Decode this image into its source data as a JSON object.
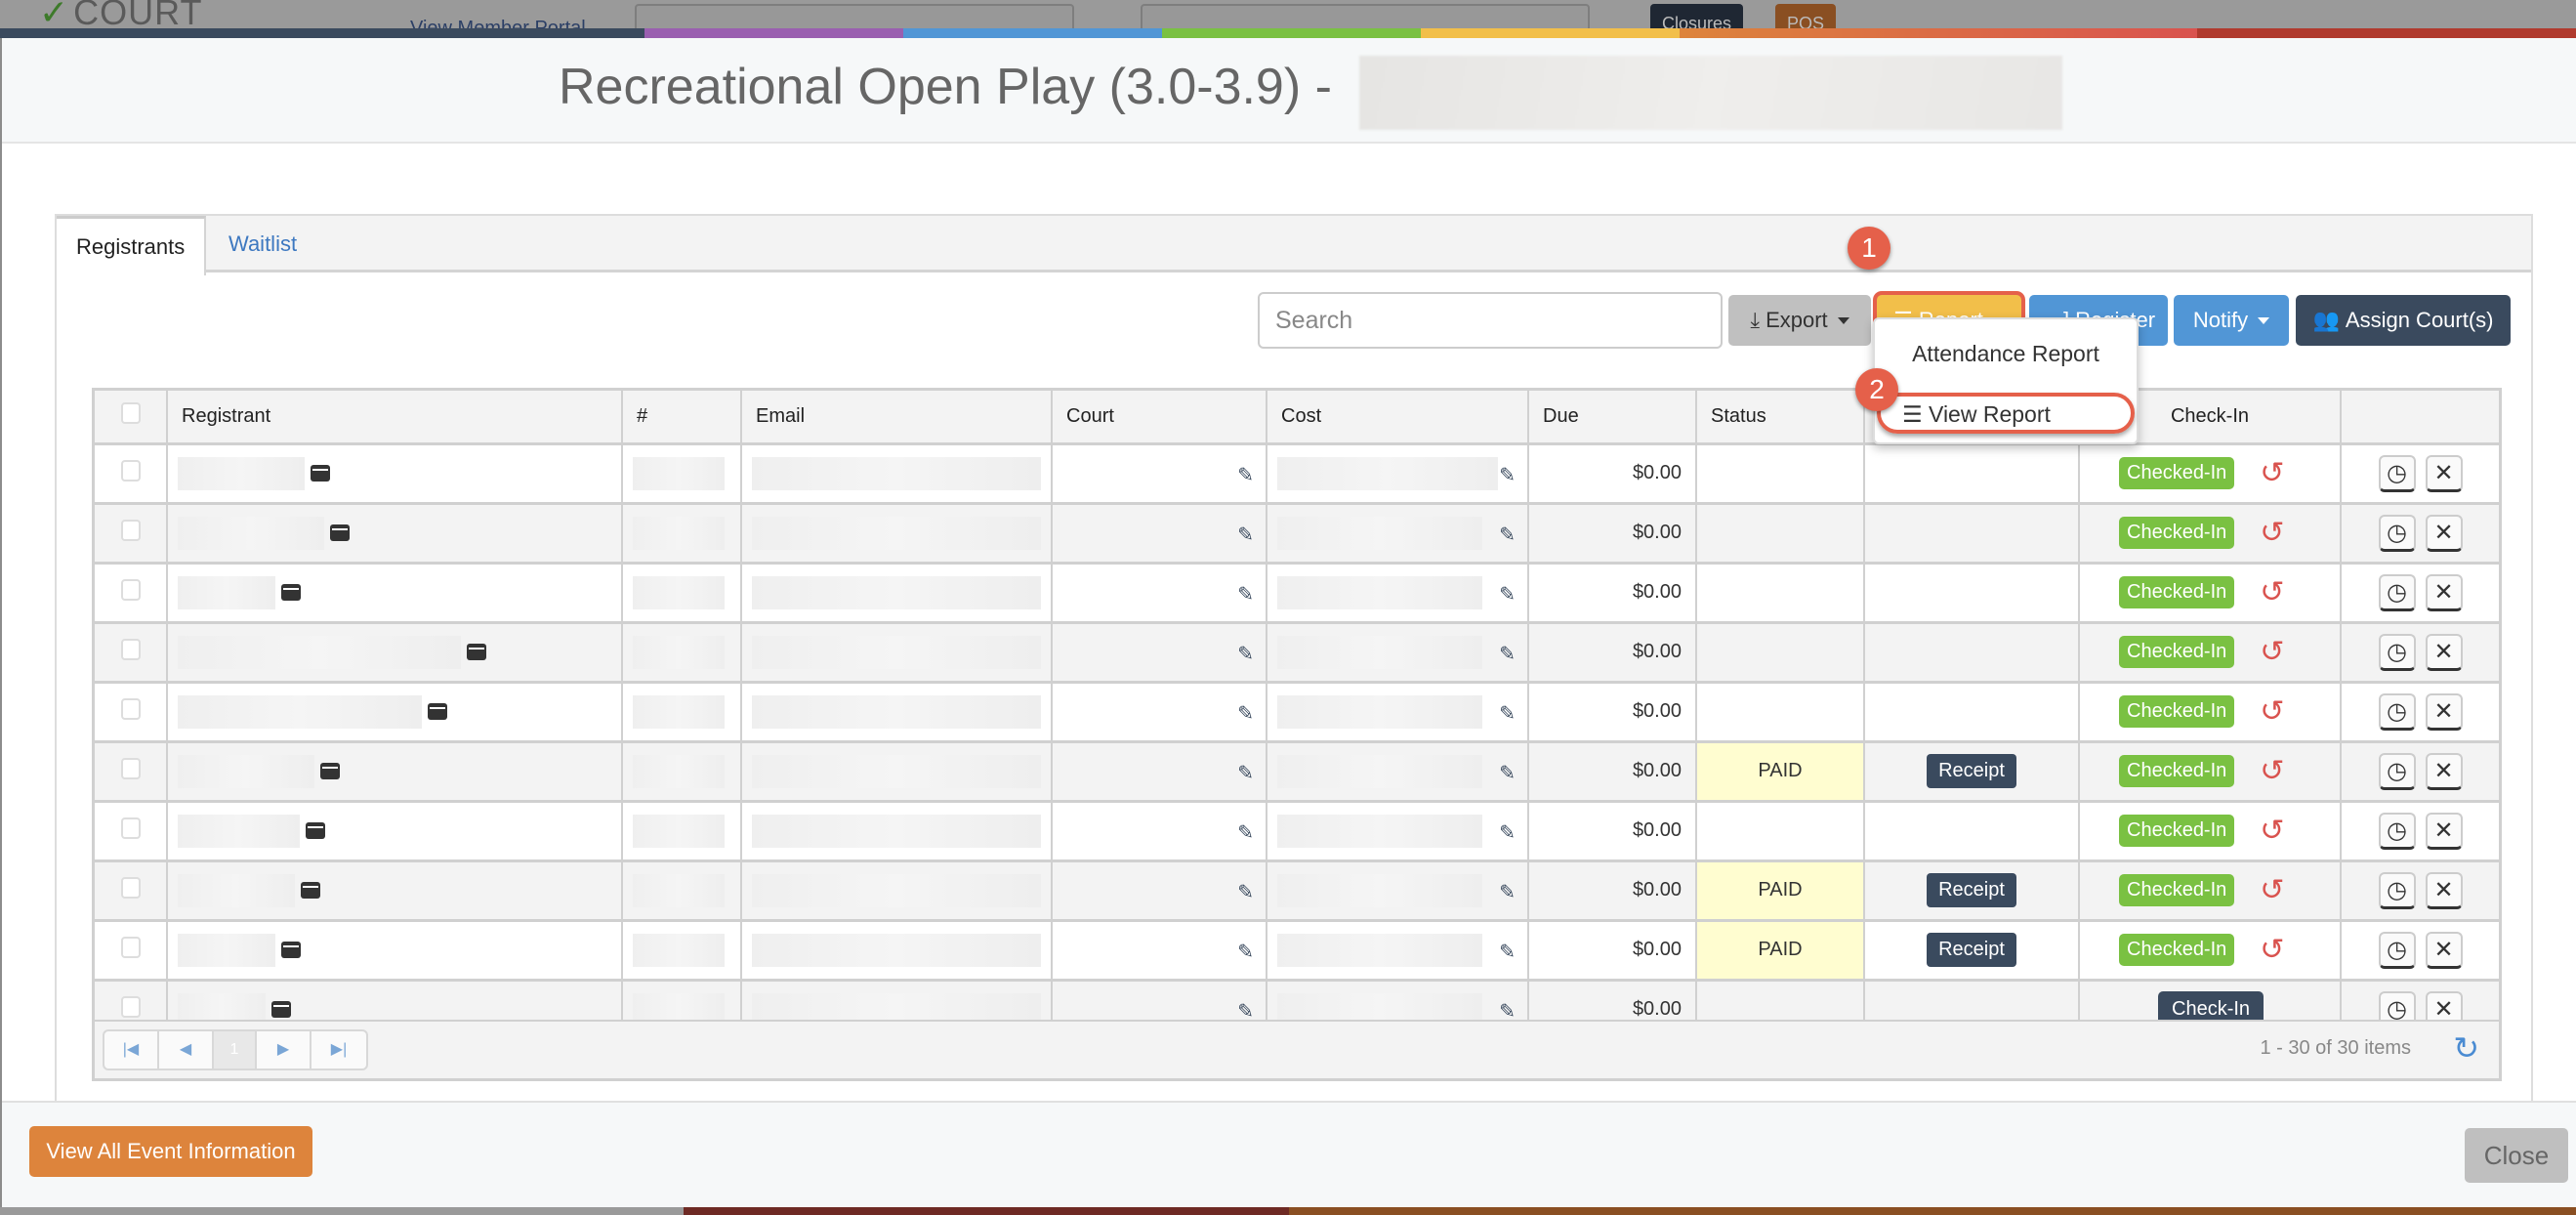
{
  "background_app": {
    "logo_text": "COURT",
    "nav_link": "View Member Portal",
    "closures_label": "Closures",
    "pos_label": "POS",
    "colorbar": [
      "#3a4a5e",
      "#9a5fb0",
      "#5196d6",
      "#7ac142",
      "#f2bf4a",
      "#dd843c",
      "#d9534f",
      "#b03a2e"
    ]
  },
  "modal": {
    "title": "Recreational Open Play (3.0-3.9) -",
    "tabs": [
      {
        "label": "Registrants",
        "active": true
      },
      {
        "label": "Waitlist",
        "active": false
      }
    ],
    "toolbar": {
      "search_placeholder": "Search",
      "export_label": "Export",
      "report_label": "Report",
      "register_label": "Register",
      "notify_label": "Notify",
      "assign_label": "Assign Court(s)"
    },
    "annotations": {
      "step1": "1",
      "step2": "2"
    },
    "report_menu": {
      "items": [
        {
          "label": "Attendance Report"
        },
        {
          "label": "View Report",
          "highlighted": true
        }
      ]
    },
    "table": {
      "columns": [
        "",
        "Registrant",
        "#",
        "Email",
        "Court",
        "Cost",
        "Due",
        "Status",
        "",
        "Check-In",
        ""
      ],
      "rows": [
        {
          "due": "$0.00",
          "status": "",
          "receipt": "",
          "checkin": "Checked-In"
        },
        {
          "due": "$0.00",
          "status": "",
          "receipt": "",
          "checkin": "Checked-In"
        },
        {
          "due": "$0.00",
          "status": "",
          "receipt": "",
          "checkin": "Checked-In"
        },
        {
          "due": "$0.00",
          "status": "",
          "receipt": "",
          "checkin": "Checked-In"
        },
        {
          "due": "$0.00",
          "status": "",
          "receipt": "",
          "checkin": "Checked-In"
        },
        {
          "due": "$0.00",
          "status": "PAID",
          "receipt": "Receipt",
          "checkin": "Checked-In"
        },
        {
          "due": "$0.00",
          "status": "",
          "receipt": "",
          "checkin": "Checked-In"
        },
        {
          "due": "$0.00",
          "status": "PAID",
          "receipt": "Receipt",
          "checkin": "Checked-In"
        },
        {
          "due": "$0.00",
          "status": "PAID",
          "receipt": "Receipt",
          "checkin": "Checked-In"
        },
        {
          "due": "$0.00",
          "status": "",
          "receipt": "",
          "checkin": "Check-In"
        }
      ]
    },
    "pager": {
      "current_page": "1",
      "items_info": "1 - 30 of 30 items"
    },
    "footer": {
      "view_all_label": "View All Event Information",
      "close_label": "Close"
    }
  }
}
